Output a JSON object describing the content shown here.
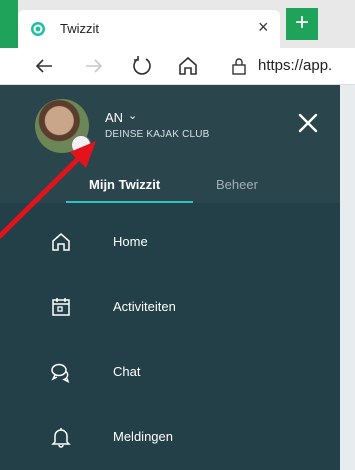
{
  "browser": {
    "tab_title": "Twizzit",
    "tab_close_glyph": "×",
    "new_tab_glyph": "+",
    "url": "https://app.",
    "icons": [
      "back-icon",
      "forward-icon",
      "refresh-icon",
      "home-icon",
      "lock-icon"
    ]
  },
  "user": {
    "name": "AN",
    "chevron": "⌄",
    "club": "DEINSE KAJAK CLUB"
  },
  "nav_tabs": [
    {
      "label": "Mijn Twizzit",
      "active": true
    },
    {
      "label": "Beheer",
      "active": false
    }
  ],
  "menu": [
    {
      "label": "Home",
      "icon": "home-icon"
    },
    {
      "label": "Activiteiten",
      "icon": "calendar-icon"
    },
    {
      "label": "Chat",
      "icon": "chat-icon"
    },
    {
      "label": "Meldingen",
      "icon": "bell-icon"
    }
  ],
  "colors": {
    "sidebar": "#233f47",
    "accent": "#2ec4c4",
    "browser_green": "#1fa25a",
    "annotation_arrow": "#e3121b"
  }
}
